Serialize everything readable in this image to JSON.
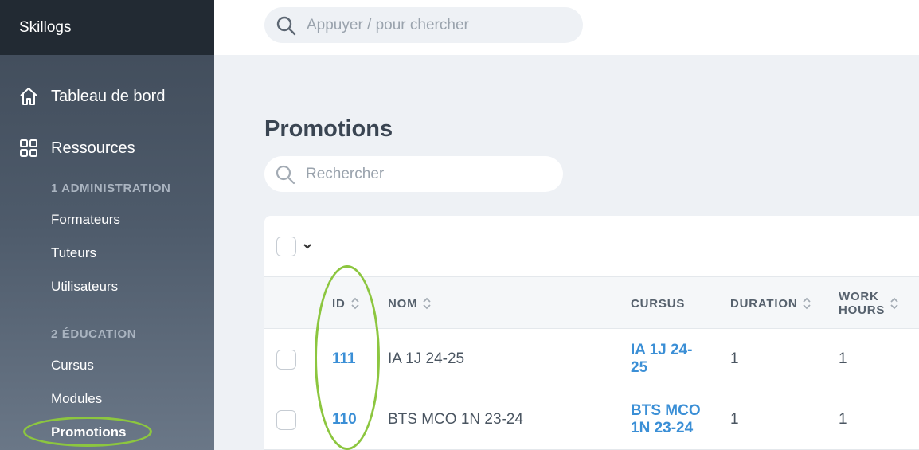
{
  "brand": "Skillogs",
  "sidebar": {
    "main": [
      {
        "label": "Tableau de bord",
        "icon": "home-icon"
      },
      {
        "label": "Ressources",
        "icon": "grid-icon"
      }
    ],
    "sections": [
      {
        "title": "1 ADMINISTRATION",
        "items": [
          "Formateurs",
          "Tuteurs",
          "Utilisateurs"
        ]
      },
      {
        "title": "2 ÉDUCATION",
        "items": [
          "Cursus",
          "Modules",
          "Promotions"
        ]
      }
    ],
    "active": "Promotions"
  },
  "topbar": {
    "search_placeholder": "Appuyer / pour chercher"
  },
  "page": {
    "title": "Promotions",
    "search_placeholder": "Rechercher"
  },
  "table": {
    "columns": [
      {
        "label": "ID",
        "sortable": true
      },
      {
        "label": "NOM",
        "sortable": true
      },
      {
        "label": "CURSUS",
        "sortable": false
      },
      {
        "label": "DURATION",
        "sortable": true
      },
      {
        "label": "WORK HOURS",
        "line1": "WORK",
        "line2": "HOURS",
        "sortable": true
      }
    ],
    "rows": [
      {
        "id": "111",
        "nom": "IA 1J 24-25",
        "cursus_line1": "IA 1J 24-",
        "cursus_line2": "25",
        "duration": "1",
        "work_hours": "1"
      },
      {
        "id": "110",
        "nom": "BTS MCO 1N 23-24",
        "cursus_line1": "BTS MCO",
        "cursus_line2": "1N 23-24",
        "duration": "1",
        "work_hours": "1"
      }
    ]
  },
  "colors": {
    "accent": "#3b8fd6",
    "highlight": "#8cc63f",
    "sidebar_dark": "#222a33"
  }
}
